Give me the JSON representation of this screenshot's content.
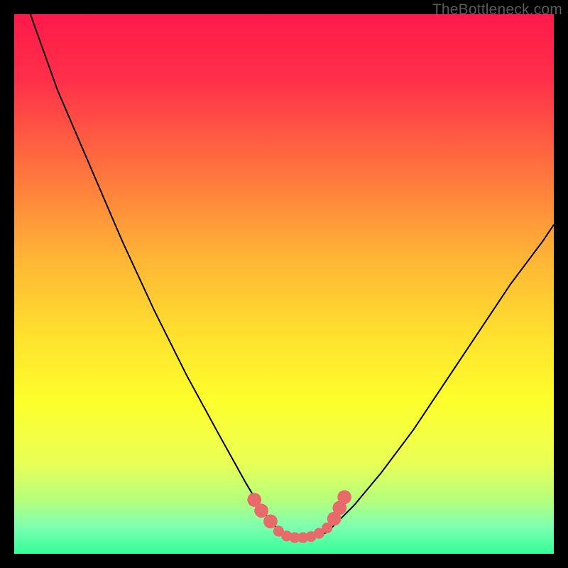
{
  "watermark": "TheBottleneck.com",
  "chart_data": {
    "type": "line",
    "title": "",
    "xlabel": "",
    "ylabel": "",
    "xlim": [
      0,
      100
    ],
    "ylim": [
      0,
      100
    ],
    "background_gradient_stops": [
      {
        "offset": 0,
        "color": "#ff1a4b"
      },
      {
        "offset": 12,
        "color": "#ff2f4a"
      },
      {
        "offset": 28,
        "color": "#ff6f3f"
      },
      {
        "offset": 45,
        "color": "#ffb436"
      },
      {
        "offset": 60,
        "color": "#ffe22e"
      },
      {
        "offset": 72,
        "color": "#fdff2c"
      },
      {
        "offset": 83,
        "color": "#eaff55"
      },
      {
        "offset": 90,
        "color": "#b6ff7c"
      },
      {
        "offset": 95,
        "color": "#7dffb0"
      },
      {
        "offset": 100,
        "color": "#33ff99"
      }
    ],
    "series": [
      {
        "name": "bottleneck-curve",
        "x": [
          3,
          8,
          14,
          20,
          26,
          32,
          38,
          43,
          46,
          48.5,
          50,
          52,
          54,
          56,
          58,
          60,
          63,
          68,
          74,
          80,
          86,
          92,
          98,
          100
        ],
        "y": [
          100,
          86,
          72,
          58,
          45,
          33,
          22,
          13,
          8,
          5,
          3.5,
          3,
          3,
          3.2,
          4,
          6,
          9,
          15,
          23,
          32,
          41,
          50,
          58,
          61
        ]
      }
    ],
    "markers": {
      "name": "valley-dots",
      "color": "#e96a6a",
      "points": [
        {
          "x": 44.5,
          "y": 10.0,
          "r": 1.3
        },
        {
          "x": 45.8,
          "y": 8.0,
          "r": 1.3
        },
        {
          "x": 47.5,
          "y": 6.0,
          "r": 1.3
        },
        {
          "x": 49.0,
          "y": 4.2,
          "r": 1.0
        },
        {
          "x": 50.5,
          "y": 3.3,
          "r": 1.0
        },
        {
          "x": 52.0,
          "y": 3.0,
          "r": 1.0
        },
        {
          "x": 53.5,
          "y": 3.0,
          "r": 1.0
        },
        {
          "x": 55.0,
          "y": 3.2,
          "r": 1.0
        },
        {
          "x": 56.5,
          "y": 3.8,
          "r": 1.0
        },
        {
          "x": 58.0,
          "y": 4.8,
          "r": 1.0
        },
        {
          "x": 59.3,
          "y": 6.5,
          "r": 1.3
        },
        {
          "x": 60.3,
          "y": 8.5,
          "r": 1.3
        },
        {
          "x": 61.2,
          "y": 10.5,
          "r": 1.3
        }
      ]
    }
  }
}
